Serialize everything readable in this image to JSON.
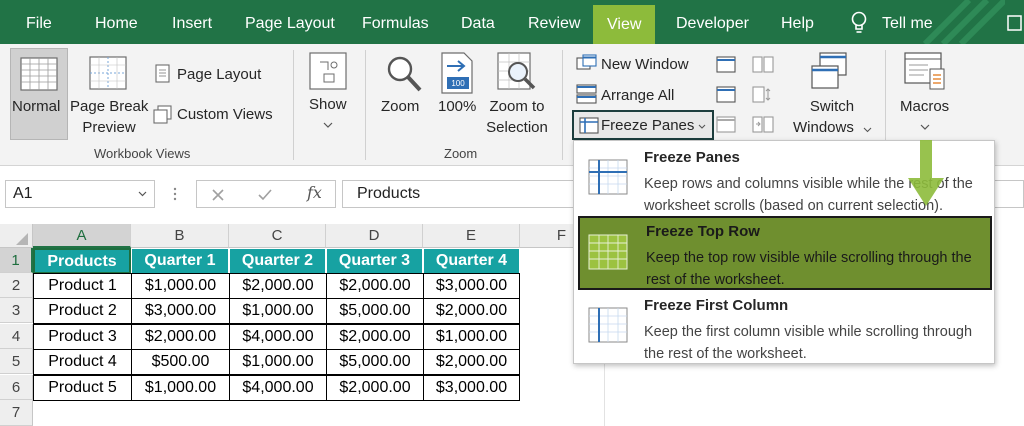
{
  "tabs": [
    {
      "label": "File"
    },
    {
      "label": "Home"
    },
    {
      "label": "Insert"
    },
    {
      "label": "Page Layout"
    },
    {
      "label": "Formulas"
    },
    {
      "label": "Data"
    },
    {
      "label": "Review"
    },
    {
      "label": "View"
    },
    {
      "label": "Developer"
    },
    {
      "label": "Help"
    },
    {
      "label": "Tell me"
    }
  ],
  "active_tab": "View",
  "ribbon": {
    "workbook_views": {
      "normal": "Normal",
      "page_break_1": "Page Break",
      "page_break_2": "Preview",
      "page_layout": "Page Layout",
      "custom_views": "Custom Views",
      "label": "Workbook Views"
    },
    "show": {
      "label": "Show"
    },
    "zoom": {
      "zoom": "Zoom",
      "hundred": "100%",
      "zoom_to_1": "Zoom to",
      "zoom_to_2": "Selection",
      "label": "Zoom",
      "hundred_icon_text": "100"
    },
    "window": {
      "new_window": "New Window",
      "arrange_all": "Arrange All",
      "freeze_panes": "Freeze Panes",
      "switch_1": "Switch",
      "switch_2": "Windows"
    },
    "macros": {
      "label": "Macros"
    }
  },
  "formula_bar": {
    "name_box": "A1",
    "fx": "fx",
    "value": "Products"
  },
  "grid": {
    "columns": [
      "A",
      "B",
      "C",
      "D",
      "E",
      "F"
    ],
    "rows": [
      "1",
      "2",
      "3",
      "4",
      "5",
      "6",
      "7"
    ],
    "header": [
      "Products",
      "Quarter 1",
      "Quarter 2",
      "Quarter 3",
      "Quarter 4"
    ],
    "data": [
      [
        "Product 1",
        "$1,000.00",
        "$2,000.00",
        "$2,000.00",
        "$3,000.00"
      ],
      [
        "Product 2",
        "$3,000.00",
        "$1,000.00",
        "$5,000.00",
        "$2,000.00"
      ],
      [
        "Product 3",
        "$2,000.00",
        "$4,000.00",
        "$2,000.00",
        "$1,000.00"
      ],
      [
        "Product 4",
        "$500.00",
        "$1,000.00",
        "$5,000.00",
        "$2,000.00"
      ],
      [
        "Product 5",
        "$1,000.00",
        "$4,000.00",
        "$2,000.00",
        "$3,000.00"
      ]
    ]
  },
  "freeze_menu": {
    "items": [
      {
        "title": "Freeze Panes",
        "desc": "Keep rows and columns visible while the rest of the worksheet scrolls (based on current selection)."
      },
      {
        "title": "Freeze Top Row",
        "desc": "Keep the top row visible while scrolling through the rest of the worksheet."
      },
      {
        "title": "Freeze First Column",
        "desc": "Keep the first column visible while scrolling through the rest of the worksheet."
      }
    ]
  },
  "colors": {
    "tab_bar": "#217346",
    "active_tab": "#8dbb3b",
    "table_header": "#17a2a2",
    "highlight": "#6f8f2f",
    "arrow": "#8dbb3b"
  }
}
